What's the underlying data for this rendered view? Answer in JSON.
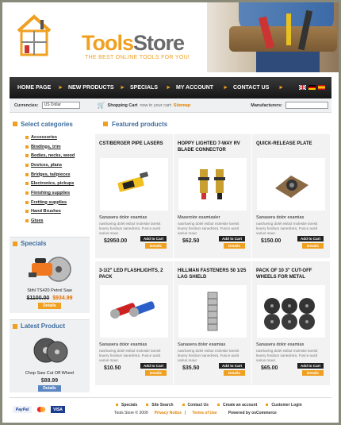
{
  "brand": {
    "tools": "Tools",
    "store": "Store",
    "tagline": "THE BEST ONLINE TOOLS FOR YOU!"
  },
  "nav": {
    "items": [
      "HOME PAGE",
      "NEW PRODUCTS",
      "SPECIALS",
      "MY ACCOUNT",
      "CONTACT US"
    ]
  },
  "subbar": {
    "currencies_label": "Currencies:",
    "currency_value": "US Dollar",
    "cart_label": "Shopping Cart",
    "cart_now": "now in your cart:",
    "cart_link": "Sitemap",
    "manufacturers_label": "Manufacturers:"
  },
  "sidebar": {
    "categories_title": "Select categories",
    "categories": [
      "Accessories",
      "Bindings, trim",
      "Bodies, necks, wood",
      "Dovices, plans",
      "Bridges, tailpieces",
      "Electronics, pickups",
      "Finishing supplies",
      "Fretting supplies",
      "Hand Brushes",
      "Glues"
    ],
    "specials_title": "Specials",
    "special_name": "Stihl TS420 Petrol Saw",
    "special_old": "$1100.00",
    "special_new": "$934.99",
    "latest_title": "Latest Product",
    "latest_name": "Chop Saw Cut Off Wheel",
    "latest_price": "$88.99",
    "details": "Details"
  },
  "main": {
    "title": "Featured products",
    "add": "Add to Cart",
    "details": "Details",
    "products": [
      {
        "title": "CST/BERGER PIPE LASERS",
        "name": "Sanasera dolor esamias",
        "desc": "nasrlueing dolel esibul molestie laresit leuery heobun sanedrera. Fusce ausit varius maur.",
        "price": "$2950.00"
      },
      {
        "title": "HOPPY LIGHTED 7-WAY RV BLADE CONNECTOR",
        "name": "Maserolor esamiasler",
        "desc": "nasrlueing dolel esibul molestie laresit leuery heobun sanedrera. Fusce ausit varius maur.",
        "price": "$62.50"
      },
      {
        "title": "QUICK-RELEASE PLATE",
        "name": "Sanasera dolor esamias",
        "desc": "nasrlueing dolel esibul molestie laresit leuery heobun sanedrera. Fusce ausit varius maur.",
        "price": "$150.00"
      },
      {
        "title": "3-1/2\" LED FLASHLIGHTS, 2 PACK",
        "name": "Sanasera dolor esamias",
        "desc": "nasrlueing dolel esibul molestie laresit leuery heobun sanedrera. Fusce ausit varius maur.",
        "price": "$10.50"
      },
      {
        "title": "HILLMAN FASTENERS 50 1/25 LAG SHIELD",
        "name": "Sanasera dolor esamias",
        "desc": "nasrlueing dolel esibul molestie laresit leuery heobun sanedrera. Fusce ausit varius maur.",
        "price": "$35.50"
      },
      {
        "title": "PACK OF 10 3\" CUT-OFF WHEELS FOR METAL",
        "name": "Sanasera dolor esamias",
        "desc": "nasrlueing dolel esibul molestie laresit leuery heobun sanedrera. Fusce ausit varius maur.",
        "price": "$65.00"
      }
    ]
  },
  "footer": {
    "pay": [
      "PayPal",
      "",
      "VISA"
    ],
    "links": [
      "Specials",
      "Site Search",
      "Contact Us",
      "Create an account",
      "Customer Login"
    ],
    "copyright": "Tools Store © 2009",
    "privacy": "Privacy Notice",
    "terms": "Terms of Use",
    "powered": "Powered by osCommerce"
  },
  "colors": {
    "accent": "#f0a020",
    "link_blue": "#3f6d9e",
    "nav_bg": "#1e1e1e"
  }
}
